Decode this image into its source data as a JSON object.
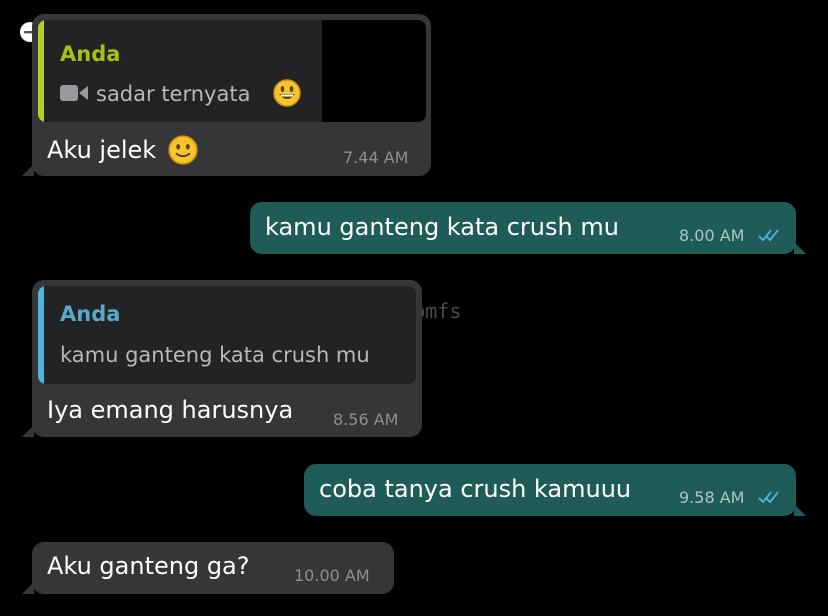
{
  "colors": {
    "background": "#000000",
    "incoming_bubble": "#363638",
    "outgoing_bubble": "#1f5c58",
    "quote_bar_1": "#b4d022",
    "quote_name_1": "#a2c21a",
    "quote_bar_2": "#4fb5e0",
    "quote_name_2": "#58a9c9",
    "read_ticks": "#4fb6ec"
  },
  "watermark": "@convomfs",
  "messages": [
    {
      "direction": "incoming",
      "reply": {
        "name": "Anda",
        "icon": "video-camera-icon",
        "text": "sadar ternyata",
        "emoji": "grinning-face-emoji",
        "thumbnail": "video-thumbnail"
      },
      "text": "Aku jelek",
      "emoji": "slightly-smiling-face-emoji",
      "time": "7.44 AM"
    },
    {
      "direction": "outgoing",
      "text": "kamu ganteng kata crush mu",
      "time": "8.00 AM",
      "status_icon": "double-check-read-icon"
    },
    {
      "direction": "incoming",
      "reply": {
        "name": "Anda",
        "text": "kamu ganteng kata crush mu"
      },
      "text": "Iya emang harusnya",
      "time": "8.56 AM"
    },
    {
      "direction": "outgoing",
      "text": "coba tanya crush kamuuu",
      "time": "9.58 AM",
      "status_icon": "double-check-read-icon"
    },
    {
      "direction": "incoming",
      "text": "Aku ganteng ga?",
      "time": "10.00 AM"
    }
  ]
}
